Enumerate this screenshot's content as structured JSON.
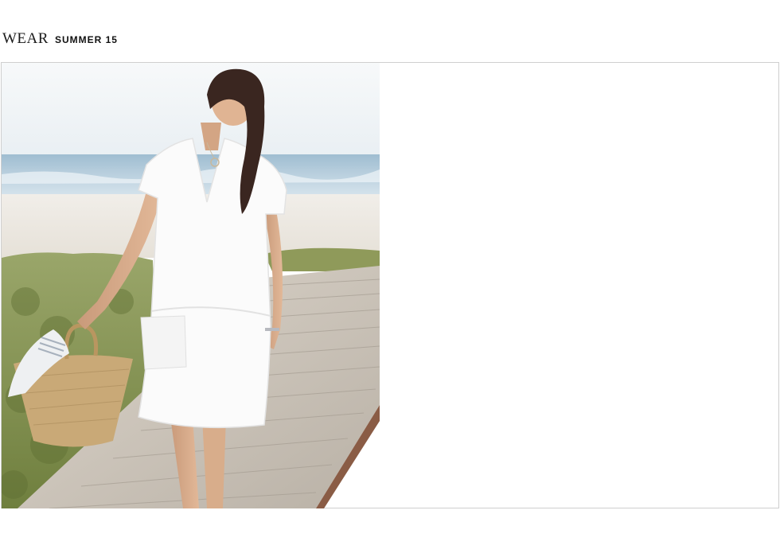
{
  "header": {
    "brand": "WEAR",
    "season": "SUMMER 15"
  },
  "hero": {
    "image": "model-white-linen-dress-beach-boardwalk"
  },
  "colors": {
    "frame_border": "#cfcfcf",
    "text": "#111111",
    "dress": "#ffffff",
    "sky": "#f2f5f7",
    "sea": "#a8c4d6",
    "dune_grass": "#7f8f4a",
    "boardwalk": "#cfc8bd",
    "basket": "#c8a978"
  }
}
